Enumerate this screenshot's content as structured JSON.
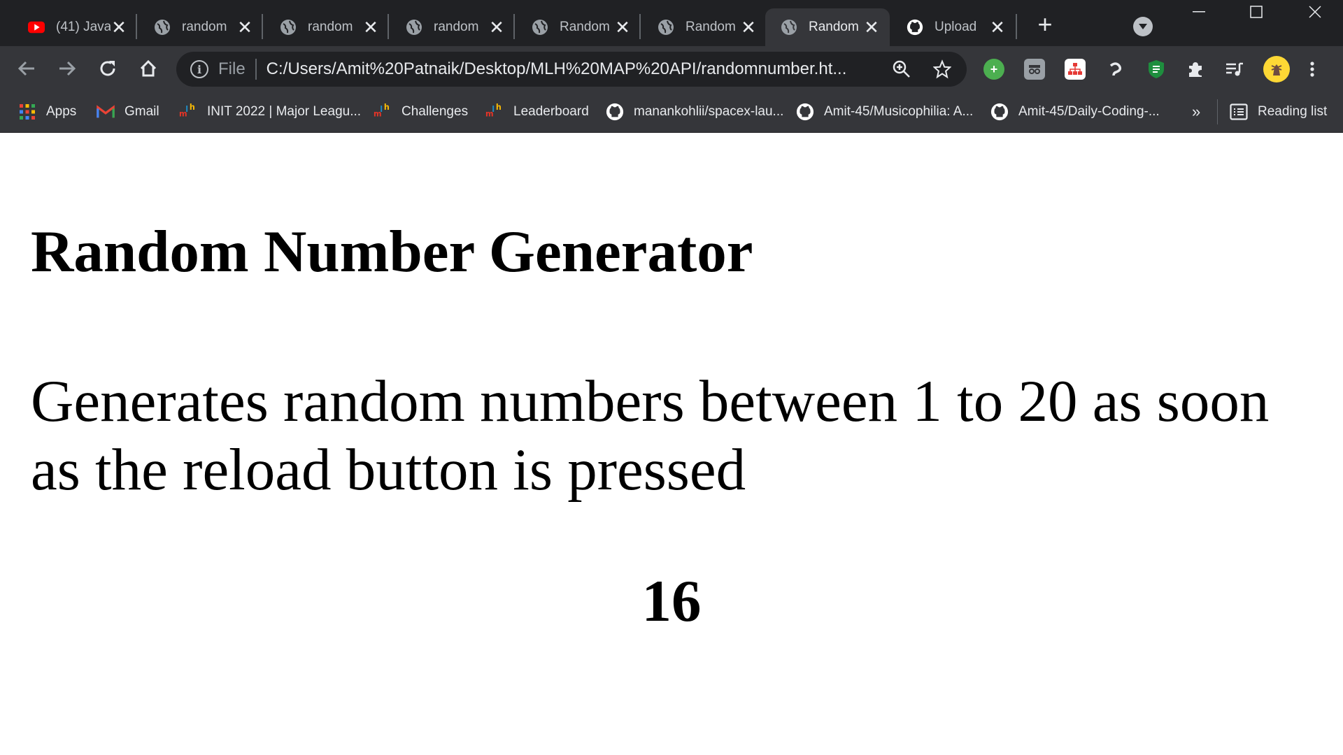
{
  "browser": {
    "tabs": [
      {
        "title": "(41) Java",
        "favicon": "youtube-icon",
        "active": false
      },
      {
        "title": "random",
        "favicon": "globe-icon",
        "active": false
      },
      {
        "title": "random",
        "favicon": "globe-icon",
        "active": false
      },
      {
        "title": "random",
        "favicon": "globe-icon",
        "active": false
      },
      {
        "title": "Random",
        "favicon": "globe-icon",
        "active": false
      },
      {
        "title": "Random",
        "favicon": "globe-icon",
        "active": false
      },
      {
        "title": "Random",
        "favicon": "globe-icon",
        "active": true
      },
      {
        "title": "Upload",
        "favicon": "github-icon",
        "active": false
      }
    ],
    "address_bar": {
      "scheme_label": "File",
      "url": "C:/Users/Amit%20Patnaik/Desktop/MLH%20MAP%20API/randomnumber.ht..."
    },
    "bookmarks": [
      {
        "label": "Apps",
        "icon": "apps-grid-icon"
      },
      {
        "label": "Gmail",
        "icon": "gmail-icon"
      },
      {
        "label": "INIT 2022 | Major Leagu...",
        "icon": "mlh-icon"
      },
      {
        "label": "Challenges",
        "icon": "mlh-icon"
      },
      {
        "label": "Leaderboard",
        "icon": "mlh-icon"
      },
      {
        "label": "manankohlii/spacex-lau...",
        "icon": "github-icon"
      },
      {
        "label": "Amit-45/Musicophilia: A...",
        "icon": "github-icon"
      },
      {
        "label": "Amit-45/Daily-Coding-...",
        "icon": "github-icon"
      }
    ],
    "overflow_label": "»",
    "reading_list_label": "Reading list"
  },
  "page": {
    "title": "Random Number Generator",
    "description": "Generates random numbers between 1 to 20 as soon as the reload button is pressed",
    "number": "16"
  },
  "colors": {
    "tabstrip_bg": "#202124",
    "toolbar_bg": "#35363a",
    "page_bg": "#ffffff",
    "text": "#000000"
  }
}
